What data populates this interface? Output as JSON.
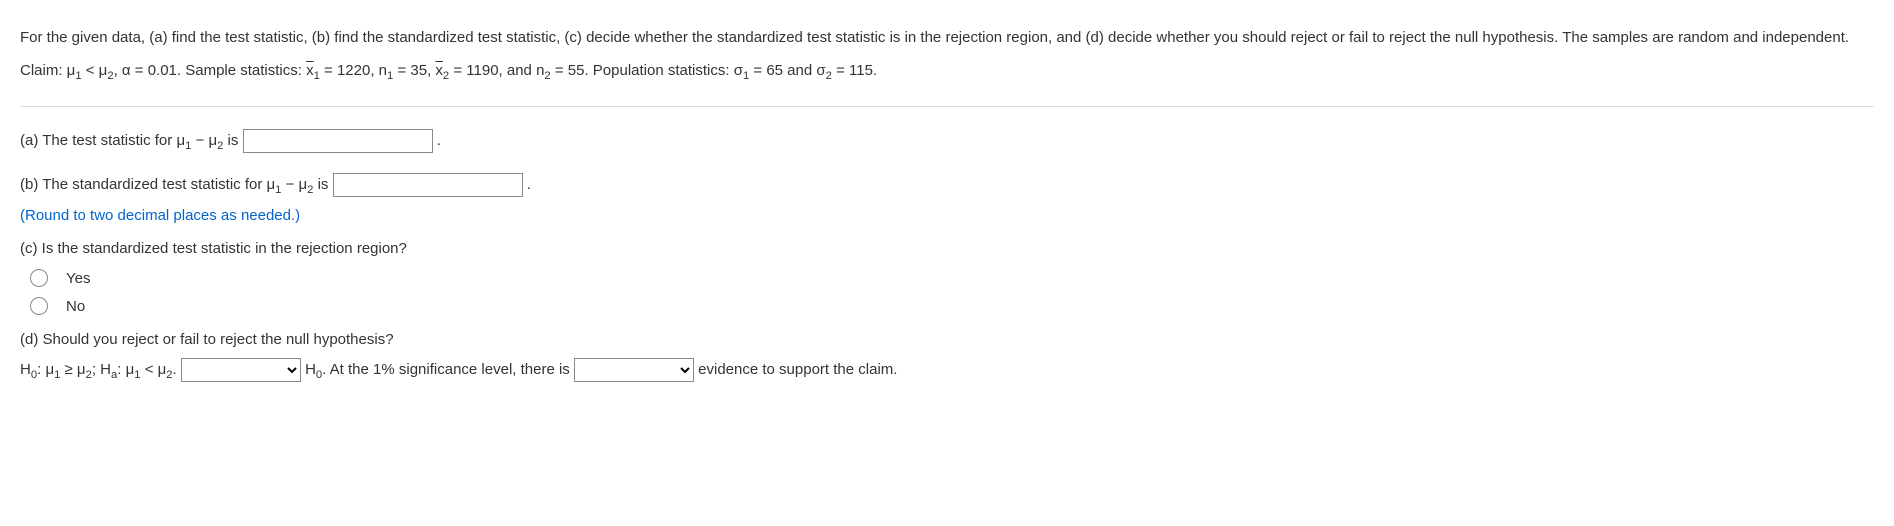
{
  "intro": {
    "line1": "For the given data, (a) find the test statistic, (b) find the standardized test statistic, (c) decide whether the standardized test statistic is in the rejection region, and (d) decide whether you should reject or fail to reject the null hypothesis. The samples are random and independent.",
    "claim_prefix": "Claim: μ",
    "claim_sub1": "1",
    "claim_mid1": " < μ",
    "claim_sub2": "2",
    "claim_mid2": ", α = 0.01. Sample statistics: ",
    "xbar1": "x",
    "xbar1_sub": "1",
    "xbar1_val": " = 1220, n",
    "n1_sub": "1",
    "n1_val": " = 35, ",
    "xbar2": "x",
    "xbar2_sub": "2",
    "xbar2_val": " = 1190, and n",
    "n2_sub": "2",
    "n2_val": " = 55. Population statistics: σ",
    "s1_sub": "1",
    "s1_val": " = 65 and σ",
    "s2_sub": "2",
    "s2_val": " = 115."
  },
  "partA": {
    "prefix": "(a) The test statistic for μ",
    "sub1": "1",
    "mid": " − μ",
    "sub2": "2",
    "suffix": " is "
  },
  "partB": {
    "prefix": "(b) The standardized test statistic for μ",
    "sub1": "1",
    "mid": " − μ",
    "sub2": "2",
    "suffix": " is ",
    "hint": "(Round to two decimal places as needed.)"
  },
  "partC": {
    "question": "(c) Is the standardized test statistic in the rejection region?",
    "opt1": "Yes",
    "opt2": "No"
  },
  "partD": {
    "question": "(d) Should you reject or fail to reject the null hypothesis?",
    "h0_prefix": "H",
    "sub0": "0",
    "h0_mid": ": μ",
    "h0_sub1": "1",
    "h0_geq": " ≥ μ",
    "h0_sub2": "2",
    "semicolon": "; H",
    "suba": "a",
    "ha_mid": ": μ",
    "ha_sub1": "1",
    "ha_lt": " < μ",
    "ha_sub2": "2",
    "period": ". ",
    "after_select1_a": " H",
    "after_select1_b": ". At the 1% significance level, there is ",
    "after_select2": " evidence to support the claim."
  }
}
